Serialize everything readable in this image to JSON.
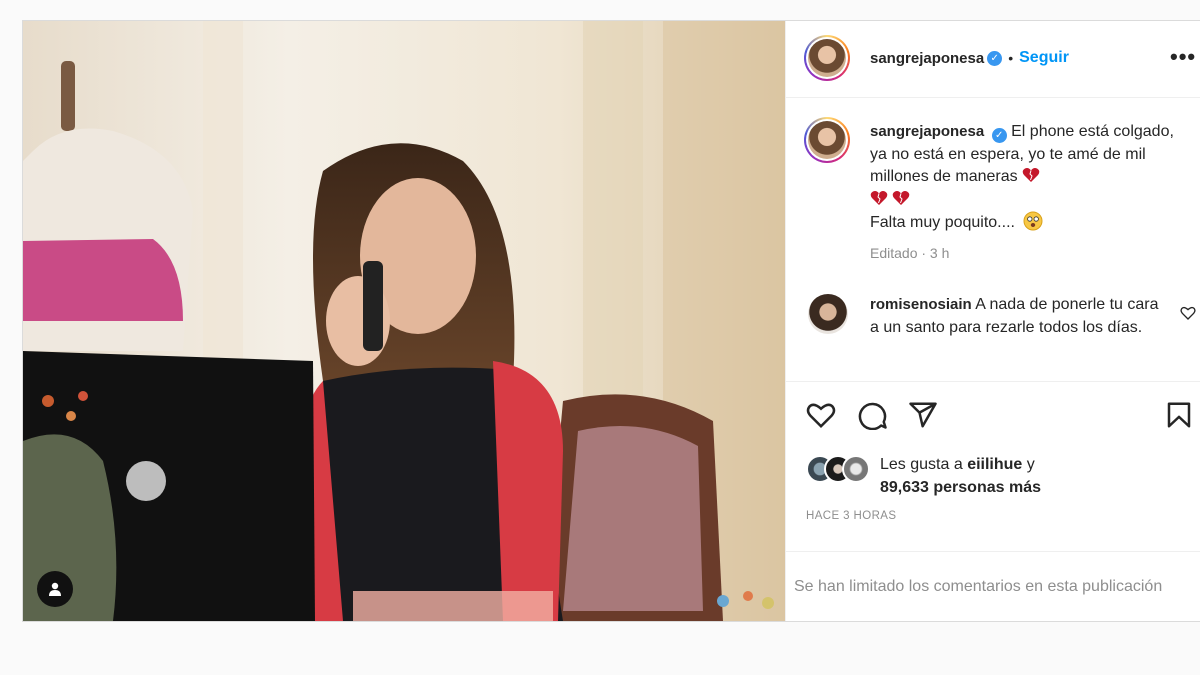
{
  "post": {
    "username": "sangrejaponesa",
    "separator": "•",
    "follow_label": "Seguir",
    "more_label": "•••",
    "caption_text": "El phone está colgado, ya no está en espera, yo te amé de mil millones de maneras",
    "caption_line2": "Falta muy poquito....",
    "edited": "Editado · 3 h"
  },
  "comment": {
    "username": "romisenosiain",
    "text": "A nada de ponerle tu cara a un santo para rezarle todos los días."
  },
  "likes": {
    "prefix": "Les gusta a",
    "user": "eiilihue",
    "joiner": "y",
    "count_text": "89,633 personas más"
  },
  "timestamp": "HACE 3 HORAS",
  "comments_limited": "Se han limitado los comentarios en esta publicación",
  "colors": {
    "accent": "#0095f6",
    "verified": "#3897f0",
    "muted": "#8e8e8e",
    "heart_emoji": "#c4182b"
  },
  "icons": [
    "user-tag-icon",
    "verified-icon",
    "more-options-icon",
    "like-icon",
    "comment-icon",
    "share-icon",
    "save-icon",
    "heart-emoji-icon",
    "dizzy-face-emoji-icon"
  ]
}
